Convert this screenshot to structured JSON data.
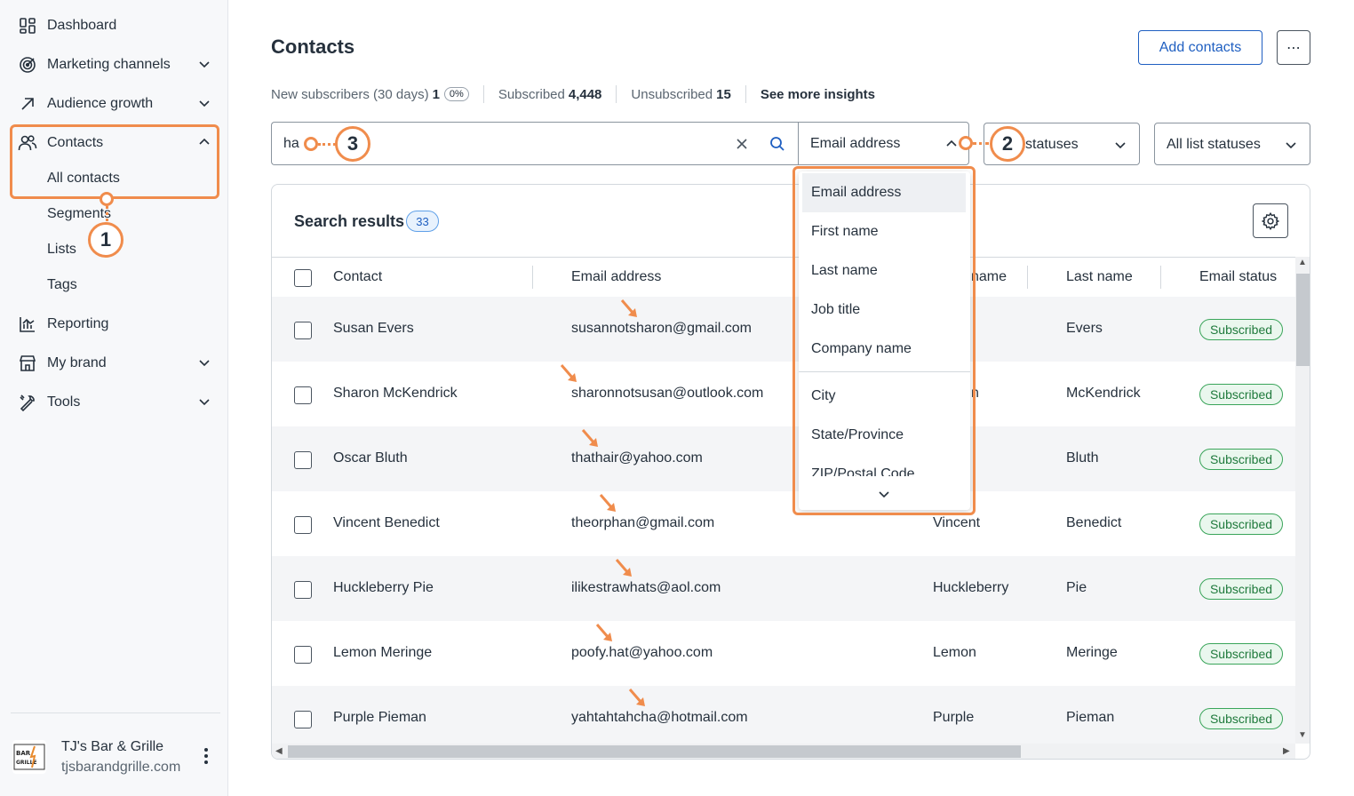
{
  "sidebar": {
    "nav": [
      {
        "label": "Dashboard",
        "icon": "dashboard-icon"
      },
      {
        "label": "Marketing channels",
        "icon": "target-icon"
      },
      {
        "label": "Audience growth",
        "icon": "arrow-up-right-icon"
      },
      {
        "label": "Contacts",
        "icon": "people-icon"
      },
      {
        "label": "Reporting",
        "icon": "bar-chart-icon"
      },
      {
        "label": "My brand",
        "icon": "storefront-icon"
      },
      {
        "label": "Tools",
        "icon": "wrench-icon"
      }
    ],
    "contacts_sub": [
      "All contacts",
      "Segments",
      "Lists",
      "Tags"
    ],
    "account": {
      "name": "TJ's Bar & Grille",
      "url": "tjsbarandgrille.com",
      "logo_text": "BAR GRILLE"
    }
  },
  "header": {
    "title": "Contacts",
    "add_contacts": "Add contacts",
    "more": "⋯"
  },
  "stats": {
    "new_label": "New subscribers (30 days)",
    "new_value": "1",
    "new_pct": "0%",
    "subscribed_label": "Subscribed",
    "subscribed_value": "4,448",
    "unsubscribed_label": "Unsubscribed",
    "unsubscribed_value": "15",
    "insights": "See more insights"
  },
  "search": {
    "value": "ha",
    "field": "Email address",
    "filter1": "statuses",
    "filter2": "All list statuses"
  },
  "results": {
    "title": "Search results",
    "count": "33",
    "headers": [
      "Contact",
      "Email address",
      "name",
      "Last name",
      "Email status"
    ],
    "rows": [
      {
        "contact": "Susan Evers",
        "email": "susannotsharon@gmail.com",
        "first": "",
        "last": "Evers",
        "status": "Subscribed"
      },
      {
        "contact": "Sharon McKendrick",
        "email": "sharonnotsusan@outlook.com",
        "first": "n",
        "last": "McKendrick",
        "status": "Subscribed"
      },
      {
        "contact": "Oscar Bluth",
        "email": "thathair@yahoo.com",
        "first": "",
        "last": "Bluth",
        "status": "Subscribed"
      },
      {
        "contact": "Vincent Benedict",
        "email": "theorphan@gmail.com",
        "first": "Vincent",
        "last": "Benedict",
        "status": "Subscribed"
      },
      {
        "contact": "Huckleberry Pie",
        "email": "ilikestrawhats@aol.com",
        "first": "Huckleberry",
        "last": "Pie",
        "status": "Subscribed"
      },
      {
        "contact": "Lemon Meringe",
        "email": "poofy.hat@yahoo.com",
        "first": "Lemon",
        "last": "Meringe",
        "status": "Subscribed"
      },
      {
        "contact": "Purple Pieman",
        "email": "yahtahtahcha@hotmail.com",
        "first": "Purple",
        "last": "Pieman",
        "status": "Subscribed"
      }
    ]
  },
  "dropdown": {
    "items": [
      "Email address",
      "First name",
      "Last name",
      "Job title",
      "Company name",
      "City",
      "State/Province",
      "ZIP/Postal Code"
    ]
  },
  "callouts": [
    "1",
    "2",
    "3"
  ],
  "colors": {
    "accent": "#1f5fc1",
    "callout": "#f08c4c",
    "subscribed": "#3aa55a"
  }
}
